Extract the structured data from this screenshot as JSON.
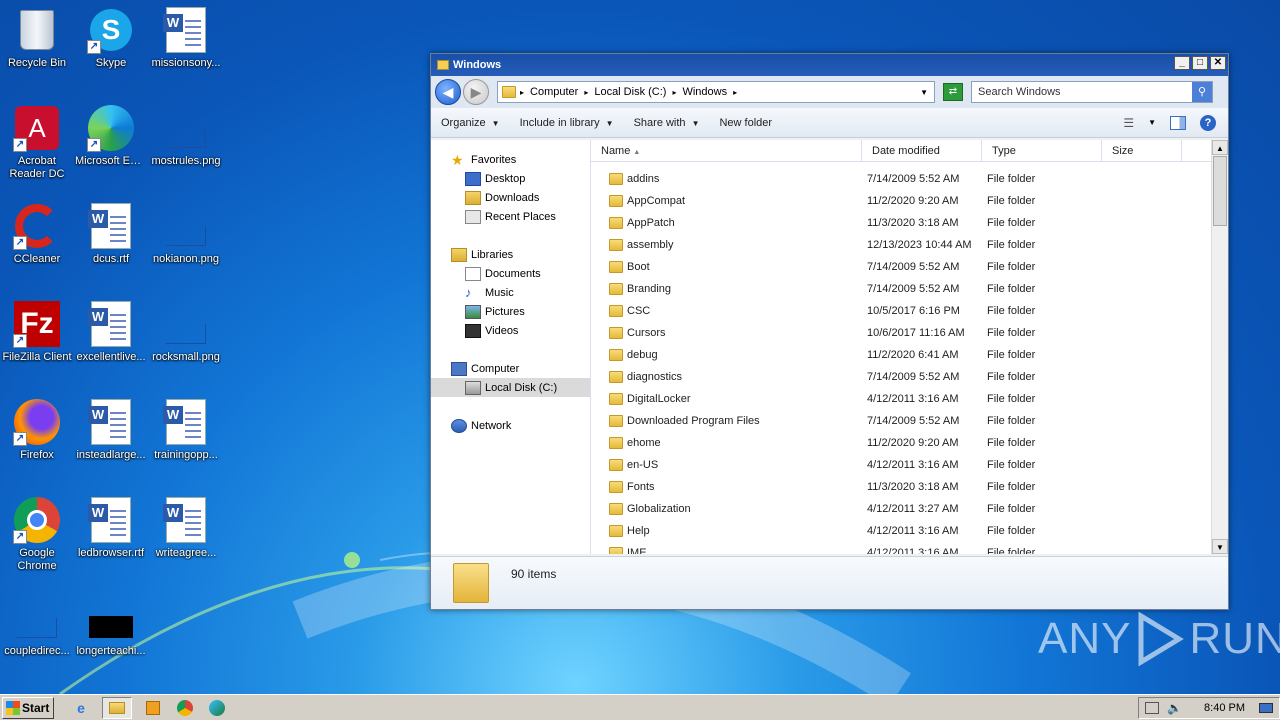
{
  "desktop": {
    "icons": [
      {
        "label": "Recycle Bin"
      },
      {
        "label": "Skype"
      },
      {
        "label": "missionsony..."
      },
      {
        "label": "Acrobat Reader DC"
      },
      {
        "label": "Microsoft Edge"
      },
      {
        "label": "mostrules.png"
      },
      {
        "label": "CCleaner"
      },
      {
        "label": "dcus.rtf"
      },
      {
        "label": "nokianon.png"
      },
      {
        "label": "FileZilla Client"
      },
      {
        "label": "excellentlive..."
      },
      {
        "label": "rocksmall.png"
      },
      {
        "label": "Firefox"
      },
      {
        "label": "insteadlarge..."
      },
      {
        "label": "trainingopp..."
      },
      {
        "label": "Google Chrome"
      },
      {
        "label": "ledbrowser.rtf"
      },
      {
        "label": "writeagree..."
      },
      {
        "label": "coupledirec..."
      },
      {
        "label": "longerteachi..."
      }
    ]
  },
  "explorer": {
    "title": "Windows",
    "breadcrumb": [
      "Computer",
      "Local Disk (C:)",
      "Windows"
    ],
    "search_placeholder": "Search Windows",
    "toolbar": {
      "organize": "Organize",
      "include": "Include in library",
      "share": "Share with",
      "newfolder": "New folder"
    },
    "nav": {
      "favorites": "Favorites",
      "desktop": "Desktop",
      "downloads": "Downloads",
      "recent": "Recent Places",
      "libraries": "Libraries",
      "documents": "Documents",
      "music": "Music",
      "pictures": "Pictures",
      "videos": "Videos",
      "computer": "Computer",
      "localdisk": "Local Disk (C:)",
      "network": "Network"
    },
    "columns": {
      "name": "Name",
      "date": "Date modified",
      "type": "Type",
      "size": "Size"
    },
    "files": [
      {
        "name": "addins",
        "date": "7/14/2009 5:52 AM",
        "type": "File folder"
      },
      {
        "name": "AppCompat",
        "date": "11/2/2020 9:20 AM",
        "type": "File folder"
      },
      {
        "name": "AppPatch",
        "date": "11/3/2020 3:18 AM",
        "type": "File folder"
      },
      {
        "name": "assembly",
        "date": "12/13/2023 10:44 AM",
        "type": "File folder"
      },
      {
        "name": "Boot",
        "date": "7/14/2009 5:52 AM",
        "type": "File folder"
      },
      {
        "name": "Branding",
        "date": "7/14/2009 5:52 AM",
        "type": "File folder"
      },
      {
        "name": "CSC",
        "date": "10/5/2017 6:16 PM",
        "type": "File folder"
      },
      {
        "name": "Cursors",
        "date": "10/6/2017 11:16 AM",
        "type": "File folder"
      },
      {
        "name": "debug",
        "date": "11/2/2020 6:41 AM",
        "type": "File folder"
      },
      {
        "name": "diagnostics",
        "date": "7/14/2009 5:52 AM",
        "type": "File folder"
      },
      {
        "name": "DigitalLocker",
        "date": "4/12/2011 3:16 AM",
        "type": "File folder"
      },
      {
        "name": "Downloaded Program Files",
        "date": "7/14/2009 5:52 AM",
        "type": "File folder"
      },
      {
        "name": "ehome",
        "date": "11/2/2020 9:20 AM",
        "type": "File folder"
      },
      {
        "name": "en-US",
        "date": "4/12/2011 3:16 AM",
        "type": "File folder"
      },
      {
        "name": "Fonts",
        "date": "11/3/2020 3:18 AM",
        "type": "File folder"
      },
      {
        "name": "Globalization",
        "date": "4/12/2011 3:27 AM",
        "type": "File folder"
      },
      {
        "name": "Help",
        "date": "4/12/2011 3:16 AM",
        "type": "File folder"
      },
      {
        "name": "IME",
        "date": "4/12/2011 3:16 AM",
        "type": "File folder"
      }
    ],
    "item_count": "90 items"
  },
  "watermark": {
    "left": "ANY",
    "right": "RUN"
  },
  "taskbar": {
    "start": "Start",
    "clock": "8:40 PM"
  }
}
